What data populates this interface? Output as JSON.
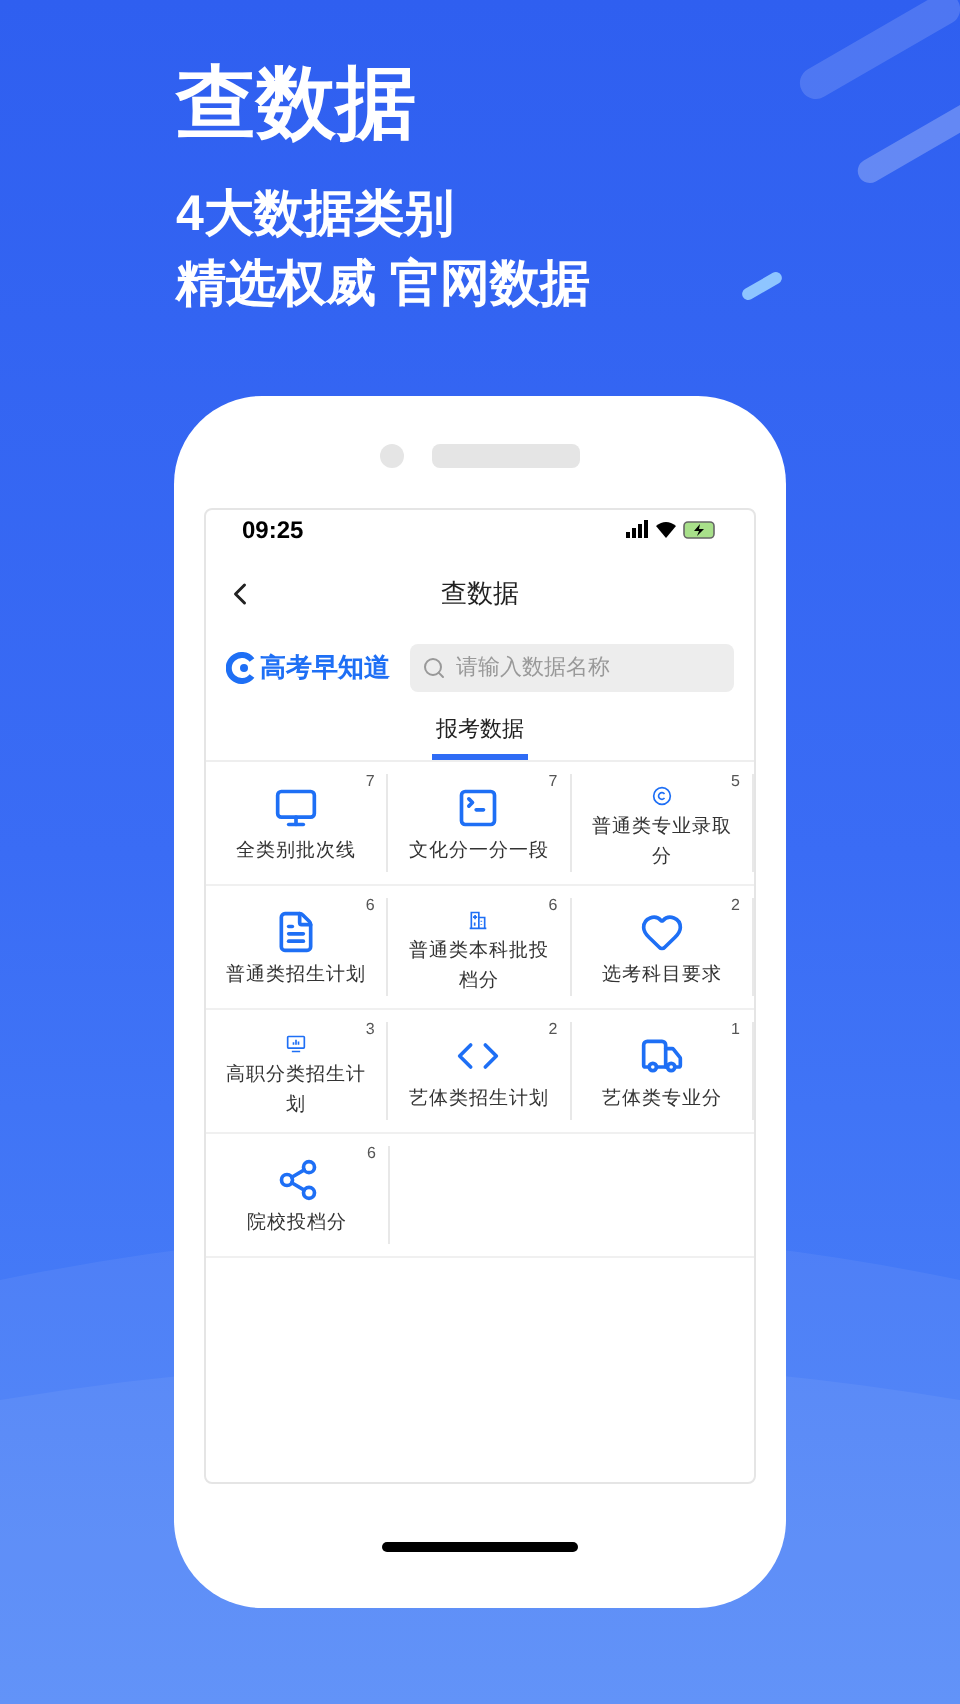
{
  "hero": {
    "title": "查数据",
    "lines": [
      "4大数据类别",
      "精选权威 官网数据"
    ]
  },
  "status_bar": {
    "time": "09:25"
  },
  "nav": {
    "title": "查数据"
  },
  "brand": {
    "name": "高考早知道"
  },
  "search": {
    "placeholder": "请输入数据名称"
  },
  "tabs": [
    {
      "label": "报考数据",
      "selected": true
    }
  ],
  "items": [
    {
      "label": "全类别批次线",
      "count": "7"
    },
    {
      "label": "文化分一分一段",
      "count": "7"
    },
    {
      "label": "普通类专业录取分",
      "count": "5"
    },
    {
      "label": "普通类招生计划",
      "count": "6"
    },
    {
      "label": "普通类本科批投档分",
      "count": "6"
    },
    {
      "label": "选考科目要求",
      "count": "2"
    },
    {
      "label": "高职分类招生计划",
      "count": "3"
    },
    {
      "label": "艺体类招生计划",
      "count": "2"
    },
    {
      "label": "艺体类专业分",
      "count": "1"
    },
    {
      "label": "院校投档分",
      "count": "6"
    }
  ]
}
